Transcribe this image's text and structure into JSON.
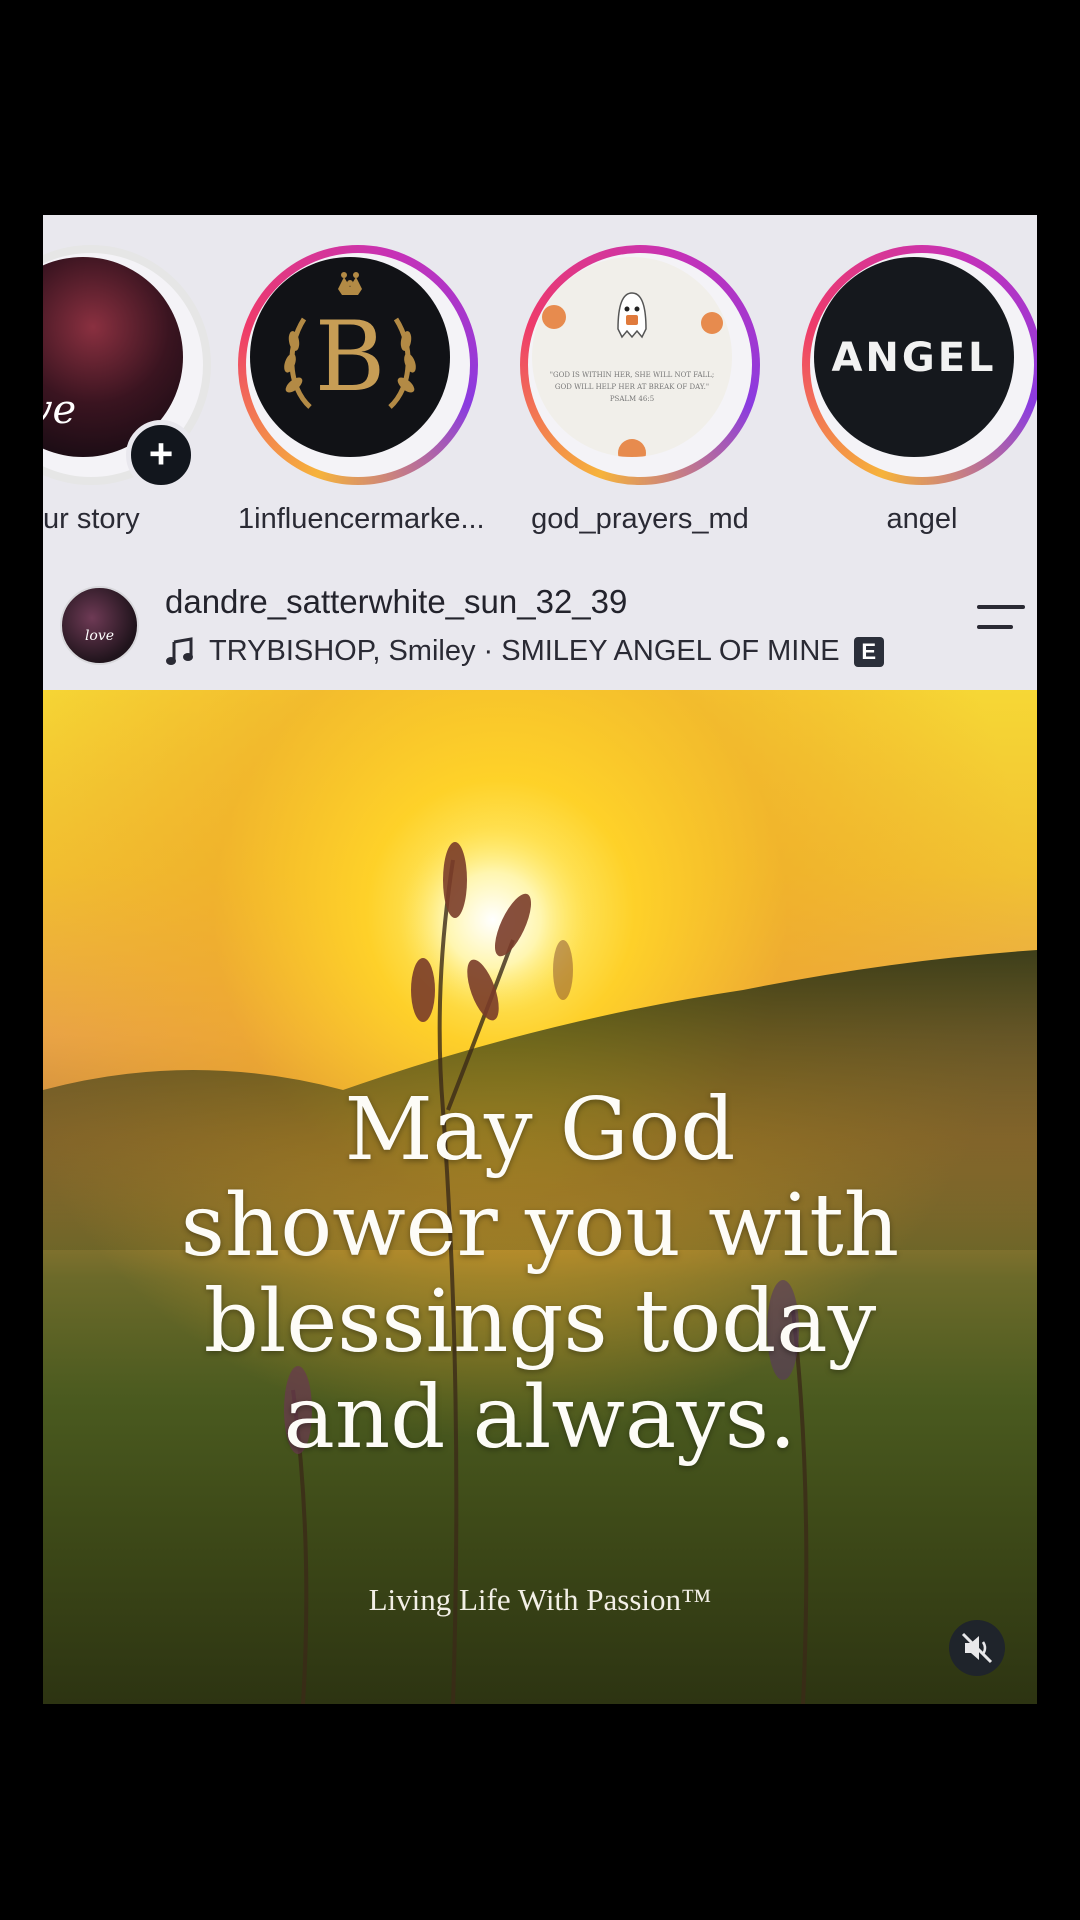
{
  "stories": [
    {
      "label": "ur story",
      "name": "your-story",
      "has_add": true
    },
    {
      "label": "1influencermarke...",
      "name": "story-1influencermarke"
    },
    {
      "label": "god_prayers_md",
      "name": "story-god-prayers-md"
    },
    {
      "label": "angel",
      "name": "story-angel"
    }
  ],
  "your_story": {
    "avatar_text": "love",
    "add_symbol": "+"
  },
  "story_b": {
    "letter": "B"
  },
  "story_angel": {
    "text": "ANGEL"
  },
  "story_prayer": {
    "line1": "\"GOD IS WITHIN HER, SHE WILL NOT FALL;",
    "line2": "GOD WILL HELP HER AT BREAK OF DAY.\"",
    "line3": "PSALM 46:5"
  },
  "post": {
    "username": "dandre_satterwhite_sun_32_39",
    "music": "TRYBISHOP, Smiley · SMILEY ANGEL OF MINE",
    "explicit_badge": "E",
    "avatar_text": "love",
    "quote_lines": [
      "May God",
      "shower you with",
      "blessings today",
      "and always."
    ],
    "brand": "Living Life With Passion™"
  },
  "icons": {
    "music": "music-note-icon",
    "menu": "menu-icon",
    "mute": "speaker-muted-icon"
  }
}
